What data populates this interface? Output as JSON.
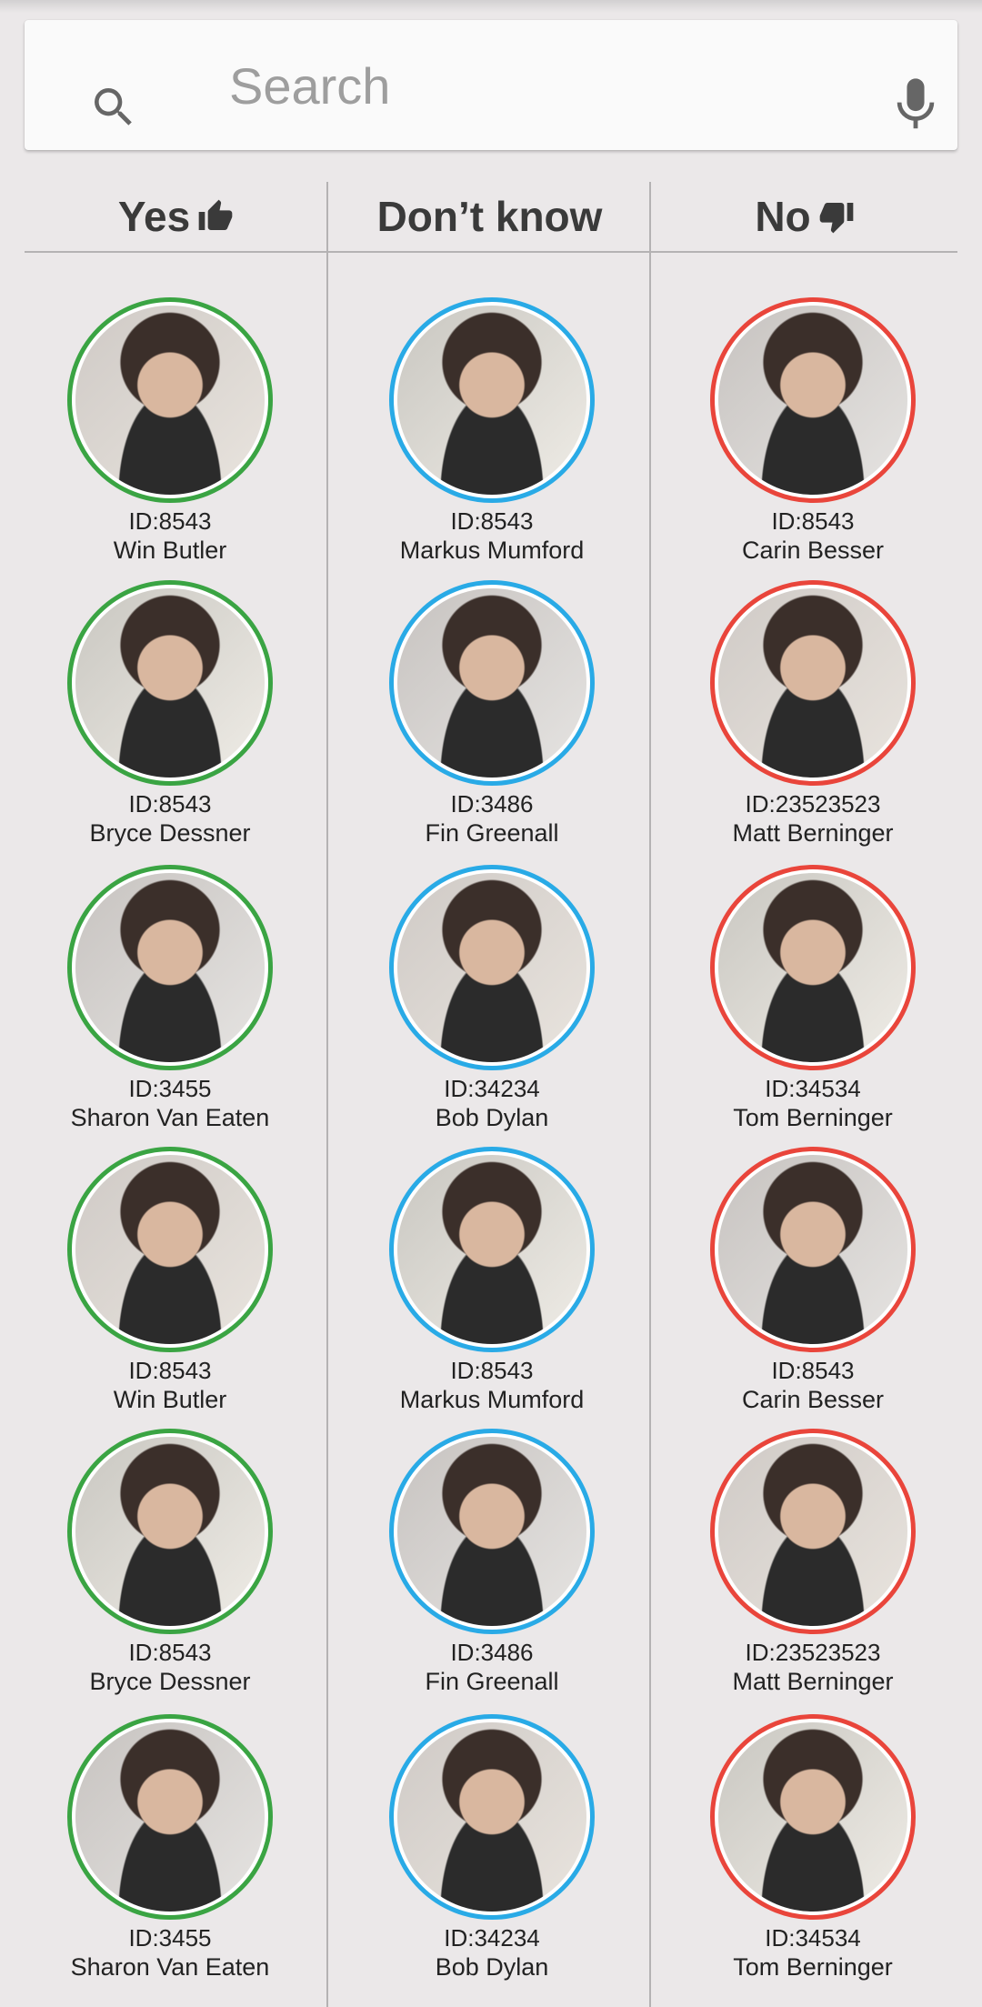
{
  "search": {
    "placeholder": "Search"
  },
  "columns": [
    {
      "title": "Yes",
      "icon": "thumbs-up-icon",
      "ring_color": "#3aa443"
    },
    {
      "title": "Don’t know",
      "icon": "",
      "ring_color": "#29aae6"
    },
    {
      "title": "No",
      "icon": "thumbs-down-icon",
      "ring_color": "#e9453b"
    }
  ],
  "rows": [
    [
      {
        "id": "ID:8543",
        "name": "Win Butler"
      },
      {
        "id": "ID:8543",
        "name": "Markus Mumford"
      },
      {
        "id": "ID:8543",
        "name": "Carin Besser"
      }
    ],
    [
      {
        "id": "ID:8543",
        "name": "Bryce Dessner"
      },
      {
        "id": "ID:3486",
        "name": "Fin Greenall"
      },
      {
        "id": "ID:23523523",
        "name": "Matt Berninger"
      }
    ],
    [
      {
        "id": "ID:3455",
        "name": "Sharon Van Eaten"
      },
      {
        "id": "ID:34234",
        "name": "Bob Dylan"
      },
      {
        "id": "ID:34534",
        "name": "Tom Berninger"
      }
    ],
    [
      {
        "id": "ID:8543",
        "name": "Win Butler"
      },
      {
        "id": "ID:8543",
        "name": "Markus Mumford"
      },
      {
        "id": "ID:8543",
        "name": "Carin Besser"
      }
    ],
    [
      {
        "id": "ID:8543",
        "name": "Bryce Dessner"
      },
      {
        "id": "ID:3486",
        "name": "Fin Greenall"
      },
      {
        "id": "ID:23523523",
        "name": "Matt Berninger"
      }
    ],
    [
      {
        "id": "ID:3455",
        "name": "Sharon Van Eaten"
      },
      {
        "id": "ID:34234",
        "name": "Bob Dylan"
      },
      {
        "id": "ID:34534",
        "name": "Tom Berninger"
      }
    ]
  ]
}
